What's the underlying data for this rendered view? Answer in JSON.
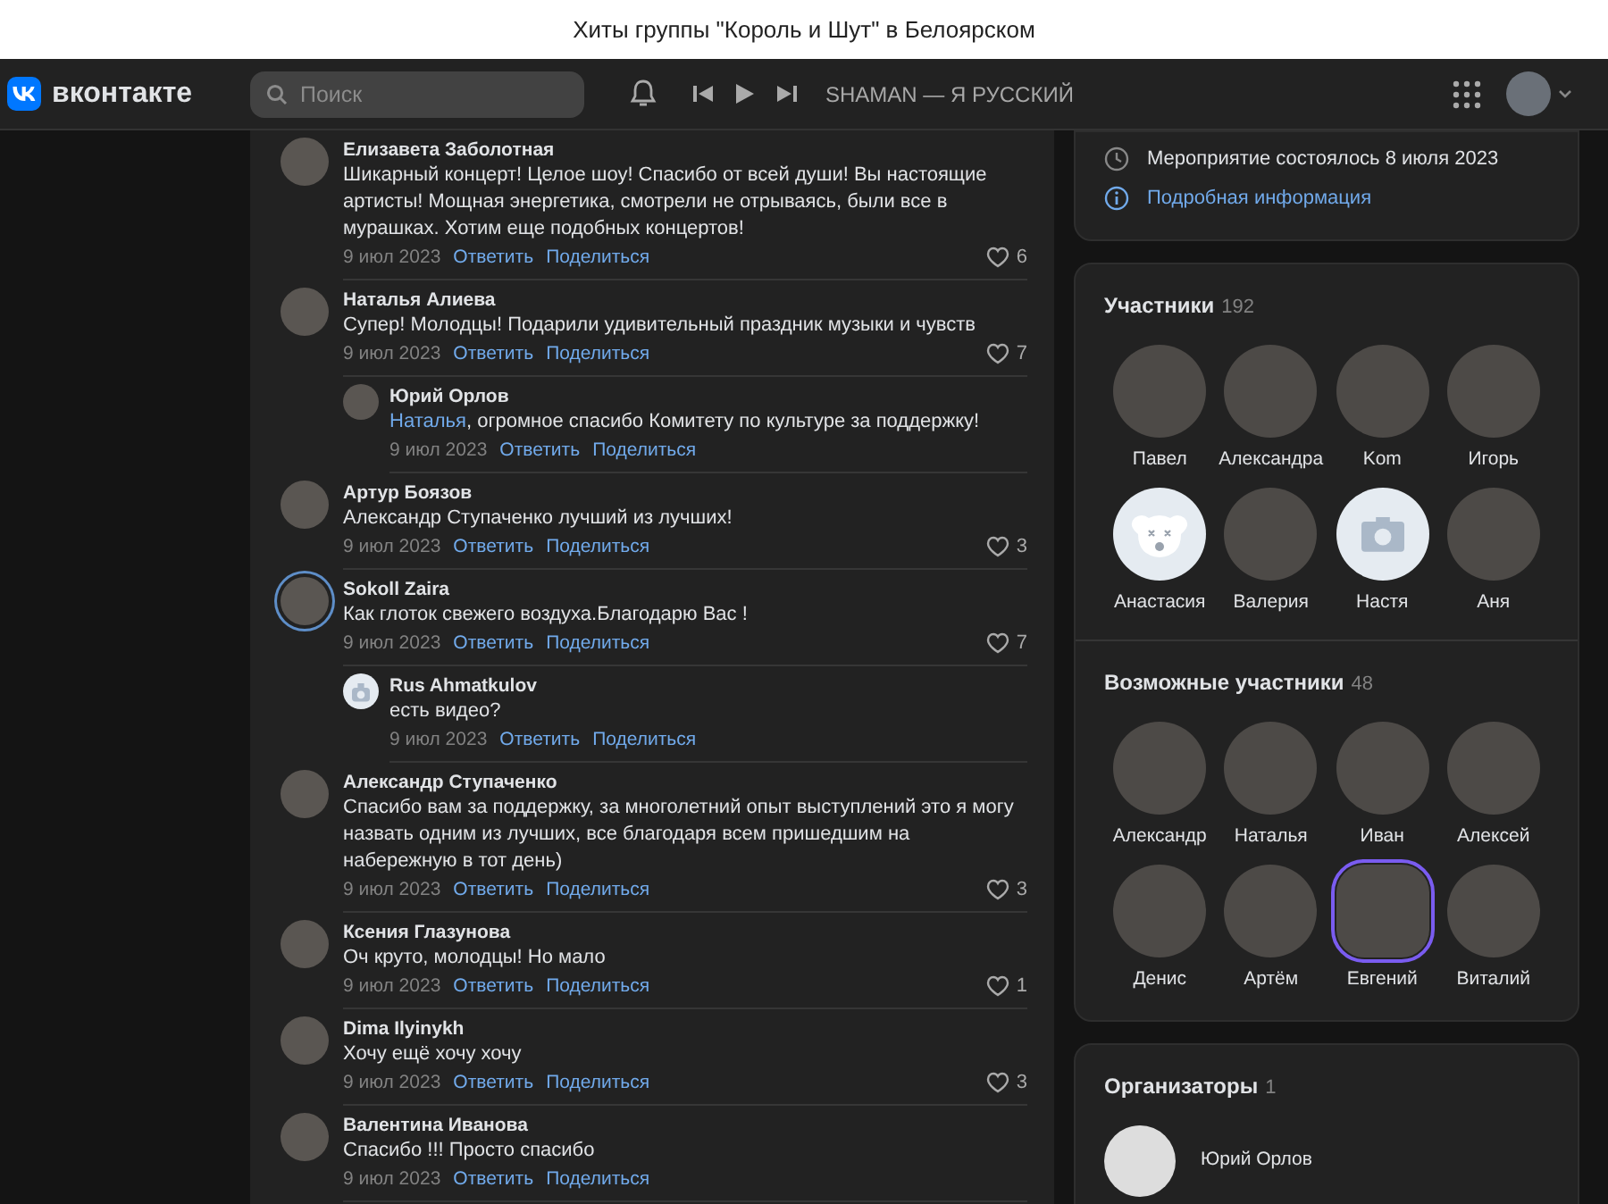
{
  "window": {
    "title": "Хиты группы \"Король и Шут\" в Белоярском"
  },
  "header": {
    "logo": "вконтакте",
    "search": {
      "placeholder": "Поиск"
    },
    "track": "SHAMAN — Я РУССКИЙ"
  },
  "comments": [
    {
      "author": "Елизавета Заболотная",
      "kind": "photo",
      "ring": false,
      "text": "Шикарный концерт! Целое шоу! Спасибо от всей души! Вы настоящие артисты! Мощная энергетика, смотрели не отрываясь, были все в мурашках. Хотим еще подобных концертов!",
      "date": "9 июл 2023",
      "reply": "Ответить",
      "share": "Поделиться",
      "likes": "6"
    },
    {
      "author": "Наталья Алиева",
      "kind": "photo",
      "ring": false,
      "text": "Супер! Молодцы! Подарили удивительный праздник музыки и чувств",
      "date": "9 июл 2023",
      "reply": "Ответить",
      "share": "Поделиться",
      "likes": "7",
      "replies": [
        {
          "author": "Юрий Орлов",
          "kind": "photo",
          "mention": "Наталья",
          "text": ", огромное спасибо Комитету по культуре за поддержку!",
          "date": "9 июл 2023",
          "reply": "Ответить",
          "share": "Поделиться"
        }
      ]
    },
    {
      "author": "Артур Боязов",
      "kind": "photo",
      "ring": false,
      "text": "Александр Ступаченко лучший из лучших!",
      "date": "9 июл 2023",
      "reply": "Ответить",
      "share": "Поделиться",
      "likes": "3"
    },
    {
      "author": "Sokoll Zaira",
      "kind": "photo",
      "ring": true,
      "text": "Как глоток свежего воздуха.Благодарю Вас !",
      "date": "9 июл 2023",
      "reply": "Ответить",
      "share": "Поделиться",
      "likes": "7",
      "replies": [
        {
          "author": "Rus Ahmatkulov",
          "kind": "camera",
          "text": "есть видео?",
          "date": "9 июл 2023",
          "reply": "Ответить",
          "share": "Поделиться"
        }
      ]
    },
    {
      "author": "Александр Ступаченко",
      "kind": "photo",
      "ring": false,
      "text": "Спасибо вам за поддержку, за многолетний опыт выступлений это я могу назвать одним из лучших, все благодаря всем пришедшим на набережную в тот день)",
      "date": "9 июл 2023",
      "reply": "Ответить",
      "share": "Поделиться",
      "likes": "3"
    },
    {
      "author": "Ксения Глазунова",
      "kind": "photo",
      "ring": false,
      "text": "Оч круто, молодцы! Но мало",
      "date": "9 июл 2023",
      "reply": "Ответить",
      "share": "Поделиться",
      "likes": "1"
    },
    {
      "author": "Dima Ilyinykh",
      "kind": "photo",
      "ring": false,
      "text": "Хочу ещё хочу хочу",
      "date": "9 июл 2023",
      "reply": "Ответить",
      "share": "Поделиться",
      "likes": "3"
    },
    {
      "author": "Валентина Иванова",
      "kind": "photo",
      "ring": false,
      "text": "Спасибо !!! Просто спасибо",
      "date": "9 июл 2023",
      "reply": "Ответить",
      "share": "Поделиться"
    }
  ],
  "event_info": {
    "status": "Мероприятие состоялось 8 июля 2023",
    "details_link": "Подробная информация"
  },
  "participants": {
    "title": "Участники",
    "count": "192",
    "people": [
      {
        "name": "Павел",
        "kind": "photo"
      },
      {
        "name": "Александра",
        "kind": "photo"
      },
      {
        "name": "Kom",
        "kind": "photo"
      },
      {
        "name": "Игорь",
        "kind": "photo"
      },
      {
        "name": "Анастасия",
        "kind": "deactivated"
      },
      {
        "name": "Валерия",
        "kind": "photo"
      },
      {
        "name": "Настя",
        "kind": "camera"
      },
      {
        "name": "Аня",
        "kind": "photo"
      }
    ]
  },
  "possible_participants": {
    "title": "Возможные участники",
    "count": "48",
    "people": [
      {
        "name": "Александр",
        "kind": "photo"
      },
      {
        "name": "Наталья",
        "kind": "photo"
      },
      {
        "name": "Иван",
        "kind": "photo"
      },
      {
        "name": "Алексей",
        "kind": "photo"
      },
      {
        "name": "Денис",
        "kind": "photo"
      },
      {
        "name": "Артём",
        "kind": "photo"
      },
      {
        "name": "Евгений",
        "kind": "hexagon"
      },
      {
        "name": "Виталий",
        "kind": "photo"
      }
    ]
  },
  "organizers": {
    "title": "Организаторы",
    "count": "1",
    "people": [
      {
        "name": "Юрий Орлов",
        "kind": "photo"
      }
    ]
  }
}
